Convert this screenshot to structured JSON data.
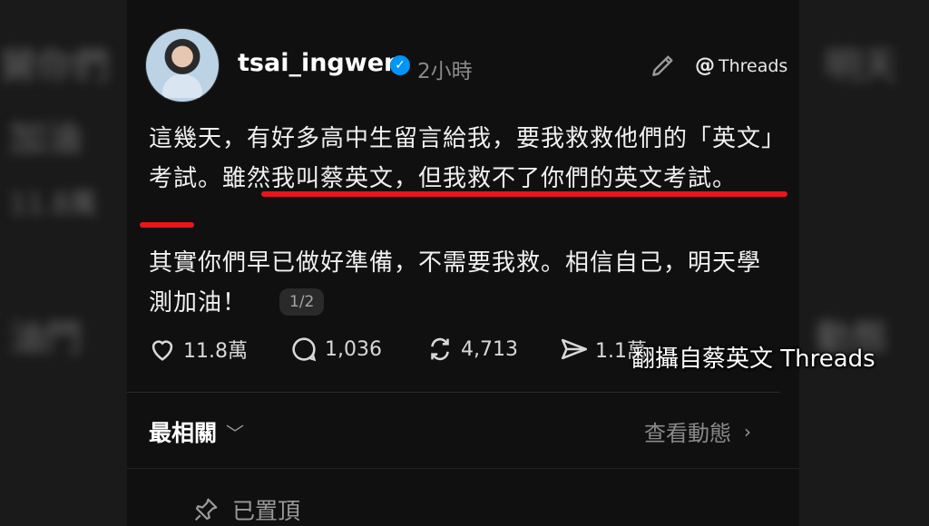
{
  "header": {
    "username": "tsai_ingwen",
    "timestamp": "2小時",
    "threads_link": "Threads",
    "verified_icon": "verified-badge-icon",
    "edit_icon": "pencil-icon"
  },
  "post": {
    "paragraph1": "這幾天，有好多高中生留言給我，要我救救他們的「英文」考試。雖然我叫蔡英文，但我救不了你們的英文考試。",
    "paragraph2": "其實你們早已做好準備，不需要我救。相信自己，明天學測加油！",
    "pager": "1/2",
    "underline_color": "#e8161b"
  },
  "actions": {
    "likes": "11.8萬",
    "replies": "1,036",
    "reposts": "4,713",
    "shares": "1.1萬"
  },
  "feed": {
    "sort_label": "最相關",
    "activity_label": "查看動態",
    "pinned_label": "已置頂"
  },
  "overlay": {
    "caption": "翻攝自蔡英文 Threads"
  },
  "background": {
    "left_blur": [
      "舅你們",
      "加油",
      "11.8萬",
      "油門"
    ],
    "right_blur": [
      "明天",
      "動態"
    ]
  }
}
